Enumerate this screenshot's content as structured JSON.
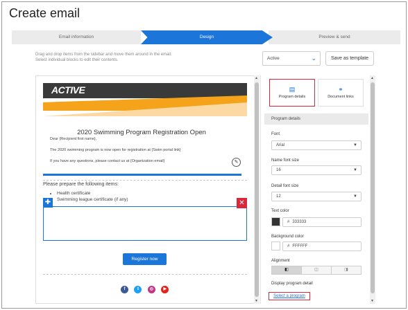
{
  "page": {
    "title": "Create email"
  },
  "stepper": {
    "steps": [
      "Email information",
      "Design",
      "Preview & send"
    ],
    "active_step": "Design"
  },
  "instructions": {
    "line1": "Drag and drop items from the sidebar and move them around in the email.",
    "line2": "Select individual blocks to edit their contents."
  },
  "status_select": {
    "value": "Active"
  },
  "save_template_label": "Save as template",
  "email": {
    "logo_text": "ACTIVE",
    "title": "2020 Swimming Program Registration Open",
    "greeting": "Dear {Recipient first name},",
    "body1": "The 2020 swimming program is now open for registration at {Swim portal link}",
    "body2": "If you have any questions, please contact us at {Organization email}",
    "prepare_text": "Please prepare the following items:",
    "items": [
      "Health certificate",
      "Swimming league certificate (if any)"
    ],
    "register_label": "Register now",
    "social_icons": [
      "facebook-icon",
      "twitter-icon",
      "instagram-icon",
      "youtube-icon"
    ]
  },
  "panel": {
    "tabs": [
      {
        "label": "Program details",
        "icon": "program-details-icon",
        "active": true
      },
      {
        "label": "Document links",
        "icon": "link-icon",
        "active": false
      }
    ],
    "section_title": "Program details",
    "font": {
      "label": "Font",
      "value": "Arial"
    },
    "name_font_size": {
      "label": "Name font size",
      "value": "16"
    },
    "detail_font_size": {
      "label": "Detail font size",
      "value": "12"
    },
    "text_color": {
      "label": "Text color",
      "hash": "#",
      "value": "333333",
      "swatch": "#333333"
    },
    "background_color": {
      "label": "Background color",
      "hash": "#",
      "value": "FFFFFF",
      "swatch": "#FFFFFF"
    },
    "alignment": {
      "label": "Alignment",
      "options": [
        "left",
        "center",
        "right"
      ],
      "selected": "left"
    },
    "display_label": "Display program detail",
    "select_program_label": "Select a program"
  },
  "colors": {
    "accent": "#1c75d9",
    "highlight": "#d9283a",
    "orange": "#f5a31a"
  }
}
